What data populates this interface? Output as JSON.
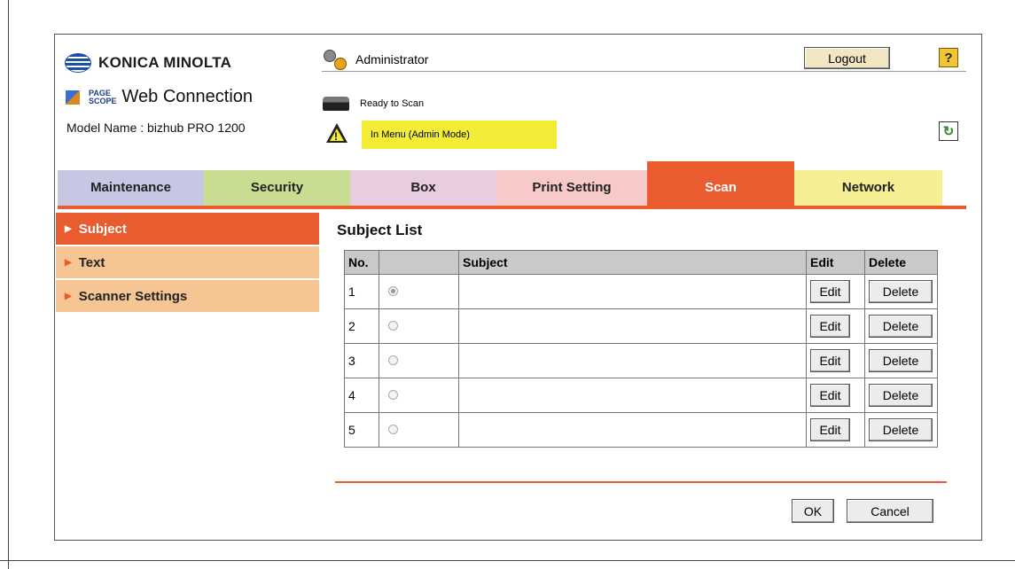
{
  "header": {
    "brand": "KONICA MINOLTA",
    "product_small_top": "PAGE",
    "product_small_bottom": "SCOPE",
    "product": "Web Connection",
    "model_name": "Model Name : bizhub PRO 1200",
    "user": "Administrator",
    "logout_label": "Logout",
    "help_label": "?",
    "status_ready": "Ready to Scan",
    "status_mode": "In Menu (Admin Mode)",
    "refresh_symbol": "↻"
  },
  "tabs": [
    {
      "label": "Maintenance"
    },
    {
      "label": "Security"
    },
    {
      "label": "Box"
    },
    {
      "label": "Print Setting"
    },
    {
      "label": "Scan"
    },
    {
      "label": "Network"
    }
  ],
  "active_tab": "Scan",
  "sidebar": {
    "items": [
      {
        "label": "Subject",
        "active": true
      },
      {
        "label": "Text",
        "active": false
      },
      {
        "label": "Scanner Settings",
        "active": false
      }
    ]
  },
  "main": {
    "title": "Subject List",
    "columns": [
      "No.",
      "",
      "Subject",
      "Edit",
      "Delete"
    ],
    "rows": [
      {
        "no": "1",
        "selected": true,
        "subject": "",
        "edit": "Edit",
        "delete": "Delete"
      },
      {
        "no": "2",
        "selected": false,
        "subject": "",
        "edit": "Edit",
        "delete": "Delete"
      },
      {
        "no": "3",
        "selected": false,
        "subject": "",
        "edit": "Edit",
        "delete": "Delete"
      },
      {
        "no": "4",
        "selected": false,
        "subject": "",
        "edit": "Edit",
        "delete": "Delete"
      },
      {
        "no": "5",
        "selected": false,
        "subject": "",
        "edit": "Edit",
        "delete": "Delete"
      }
    ],
    "ok_label": "OK",
    "cancel_label": "Cancel"
  },
  "colors": {
    "accent": "#e85c2f",
    "status_highlight": "#f2ec37"
  }
}
